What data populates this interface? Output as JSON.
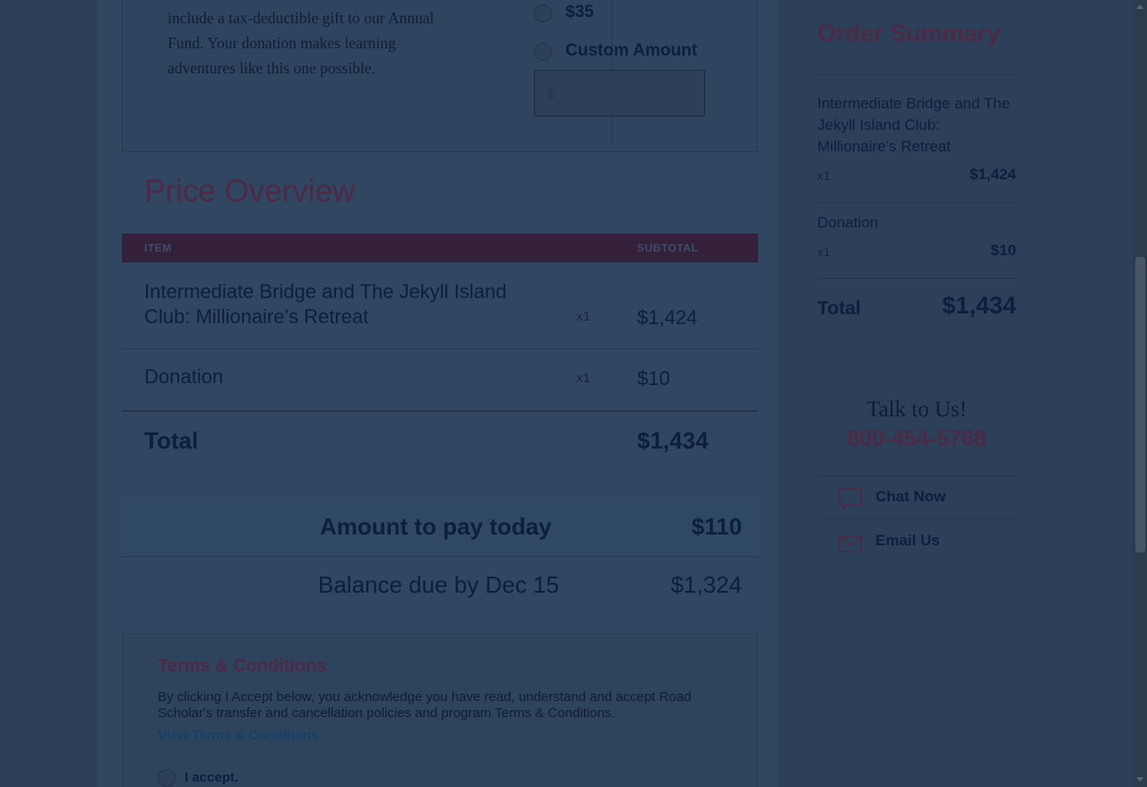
{
  "donation": {
    "text": "include a tax-deductible gift to our Annual Fund. Your donation makes learning adventures like this one possible.",
    "options": [
      "$35",
      "Custom Amount"
    ],
    "input_prefix": "$"
  },
  "price_overview": {
    "title": "Price Overview",
    "headers": {
      "item": "ITEM",
      "subtotal": "SUBTOTAL"
    },
    "rows": [
      {
        "name": "Intermediate Bridge and The Jekyll Island Club: Millionaire’s Retreat",
        "qty": "x1",
        "subtotal": "$1,424"
      },
      {
        "name": "Donation",
        "qty": "x1",
        "subtotal": "$10"
      }
    ],
    "total_label": "Total",
    "total_value": "$1,434"
  },
  "payment": {
    "today_label": "Amount to pay today",
    "today_value": "$110",
    "balance_label": "Balance due by Dec 15",
    "balance_value": "$1,324"
  },
  "terms": {
    "title": "Terms & Conditions",
    "text": "By clicking I Accept below, you acknowledge you have read, understand and accept Road Scholar's transfer and cancellation policies and program Terms & Conditions.",
    "link": "View Terms & Conditions",
    "accept_label": "I accept."
  },
  "order_summary": {
    "title": "Order Summary",
    "items": [
      {
        "name": "Intermediate Bridge and The Jekyll Island Club: Millionaire’s Retreat",
        "qty": "x1",
        "price": "$1,424"
      },
      {
        "name": "Donation",
        "qty": "x1",
        "price": "$10"
      }
    ],
    "total_label": "Total",
    "total_value": "$1,434"
  },
  "contact": {
    "heading": "Talk to Us!",
    "phone": "800-454-5768",
    "chat_label": "Chat Now",
    "email_label": "Email Us"
  },
  "icons": {
    "chat": "chat-bubble-icon",
    "email": "envelope-icon"
  },
  "colors": {
    "overlay_bg": "#2c4059",
    "accent": "#4e2945",
    "text": "#0c1f3f"
  }
}
